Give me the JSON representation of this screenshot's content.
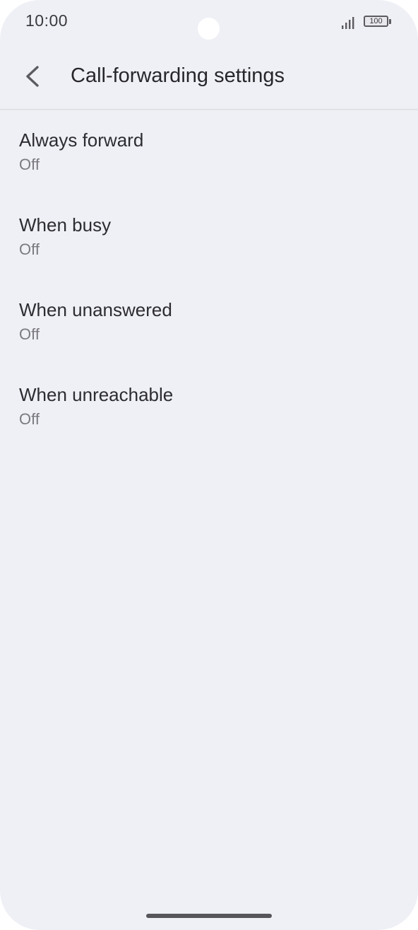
{
  "status_bar": {
    "time": "10:00",
    "battery_level": "100",
    "signal_icon": "signal-bars-icon",
    "battery_icon": "battery-icon"
  },
  "app_bar": {
    "back_icon": "chevron-left-icon",
    "title": "Call-forwarding settings"
  },
  "settings": {
    "items": [
      {
        "title": "Always forward",
        "status": "Off"
      },
      {
        "title": "When busy",
        "status": "Off"
      },
      {
        "title": "When unanswered",
        "status": "Off"
      },
      {
        "title": "When unreachable",
        "status": "Off"
      }
    ]
  },
  "colors": {
    "background": "#eff0f5",
    "title_text": "#26262b",
    "secondary_text": "#7a7a80"
  }
}
